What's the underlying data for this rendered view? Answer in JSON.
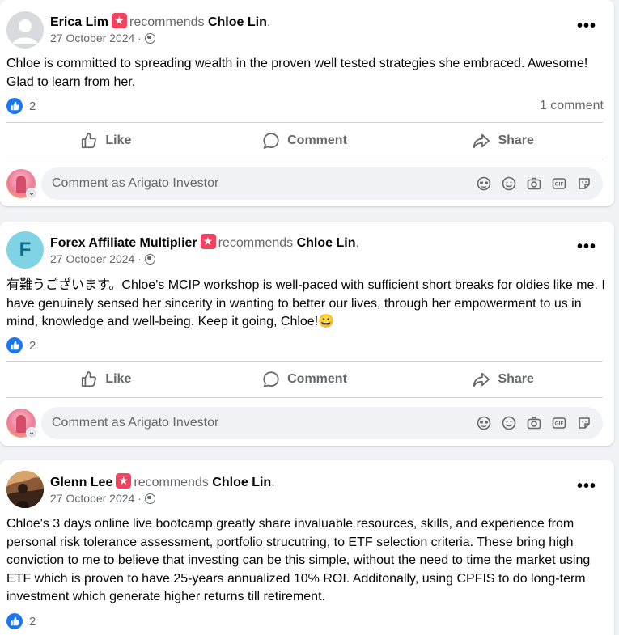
{
  "actions": {
    "like": "Like",
    "comment": "Comment",
    "share": "Share"
  },
  "composer_placeholder": "Comment as Arigato Investor",
  "colors": {
    "accent": "#1877f2",
    "recommend_badge": "#f3425f",
    "secondary_text": "#65676b"
  },
  "posts": [
    {
      "author": "Erica Lim",
      "verb": "recommends",
      "target": "Chloe Lin",
      "date": "27 October 2024",
      "text": "Chloe is committed to spreading wealth in the proven well tested strategies she embraced. Awesome! Glad to learn from her.",
      "reaction_count": "2",
      "comment_count": "1 comment"
    },
    {
      "author": "Forex Affiliate Multiplier",
      "avatar_letter": "F",
      "verb": "recommends",
      "target": "Chloe Lin",
      "date": "27 October 2024",
      "text": "有難うございます。Chloe's MCIP workshop is well-paced with sufficient short breaks for oldies like me. I have genuinely sensed her sincerity in wanting to better our lives, through her empowerment to us in mind, knowledge and well-being. Keep it going, Chloe!😀",
      "reaction_count": "2"
    },
    {
      "author": "Glenn Lee",
      "verb": "recommends",
      "target": "Chloe Lin",
      "date": "27 October 2024",
      "text": "Chloe's 3 days online live bootcamp greatly share invaluable resources, skills, and experience from personal risk tolerance assessment, portfolio strucutring, to ETF selection criteria. These bring high conviction to me to believe that investing can be this simple, without the need to time the market using ETF which is proven to have 25-years annualized 10% ROI. Additonally, using CPFIS to do long-term investment which generate higher returns till retirement.",
      "reaction_count": "2"
    }
  ]
}
